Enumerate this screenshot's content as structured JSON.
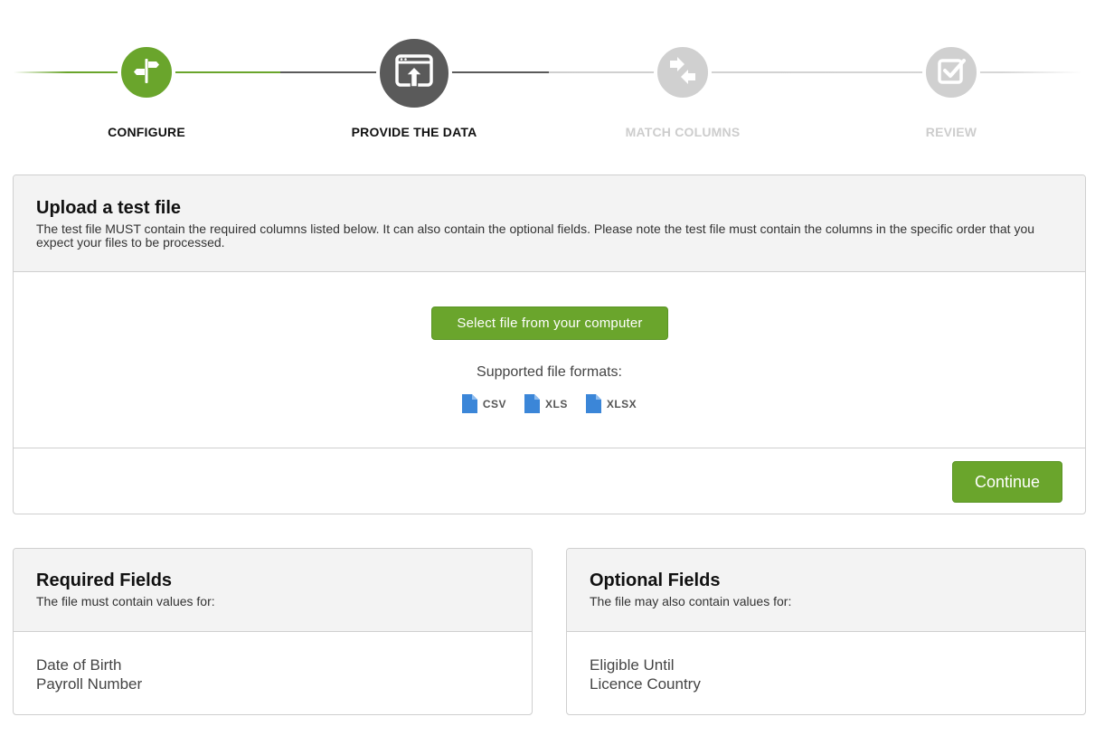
{
  "colors": {
    "accent_green": "#6aa52c",
    "active_dark": "#5a5a5a",
    "inactive_grey": "#d0d0d0"
  },
  "stepper": {
    "steps": [
      {
        "label": "CONFIGURE",
        "icon": "signpost-icon",
        "state": "completed"
      },
      {
        "label": "PROVIDE THE DATA",
        "icon": "upload-window-icon",
        "state": "active"
      },
      {
        "label": "MATCH COLUMNS",
        "icon": "match-arrows-icon",
        "state": "pending"
      },
      {
        "label": "REVIEW",
        "icon": "checkbox-icon",
        "state": "pending"
      }
    ]
  },
  "upload": {
    "title": "Upload a test file",
    "description": "The test file MUST contain the required columns listed below. It can also contain the optional fields. Please note the test file must contain the columns in the specific order that you expect your files to be processed.",
    "select_button": "Select file from your computer",
    "formats_label": "Supported file formats:",
    "formats": [
      "CSV",
      "XLS",
      "XLSX"
    ],
    "continue_button": "Continue"
  },
  "required": {
    "title": "Required Fields",
    "subtitle": "The file must contain values for:",
    "items": [
      "Date of Birth",
      "Payroll Number"
    ]
  },
  "optional": {
    "title": "Optional Fields",
    "subtitle": "The file may also contain values for:",
    "items": [
      "Eligible Until",
      "Licence Country"
    ]
  }
}
